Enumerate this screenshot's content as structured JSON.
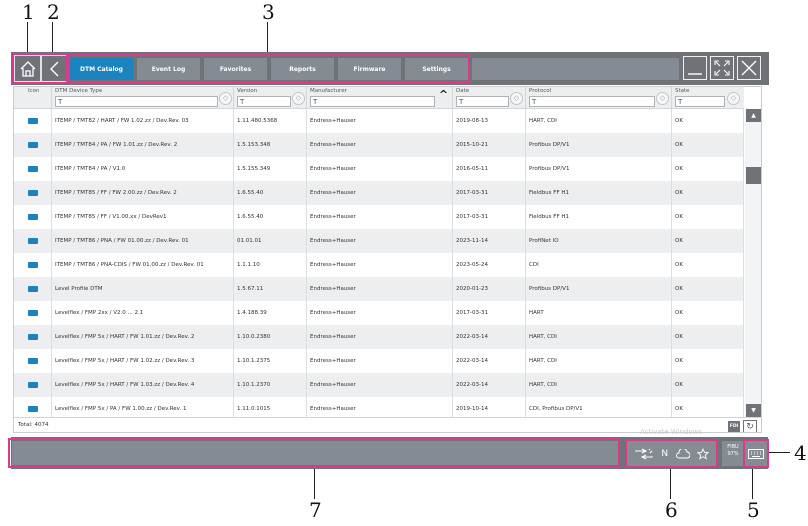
{
  "callouts": {
    "c1": "1",
    "c2": "2",
    "c3": "3",
    "c4": "4",
    "c5": "5",
    "c6": "6",
    "c7": "7"
  },
  "tabs": [
    {
      "label": "DTM Catalog",
      "active": true
    },
    {
      "label": "Event Log"
    },
    {
      "label": "Favorites"
    },
    {
      "label": "Reports"
    },
    {
      "label": "Firmware"
    },
    {
      "label": "Settings"
    }
  ],
  "icons": {
    "home": "home-icon",
    "back": "back-icon",
    "minimize": "minimize-icon",
    "fullscreen": "fullscreen-icon",
    "close": "close-icon",
    "dtm": "dtm-icon",
    "refresh": "refresh-icon",
    "network": "network-icon",
    "nfc": "nfc-icon",
    "cloud": "cloud-icon",
    "star": "star-icon",
    "keyboard": "keyboard-icon",
    "battery": "battery-icon"
  },
  "table": {
    "columns": [
      "Icon",
      "DTM Device Type",
      "Version",
      "Manufacturer",
      "Date",
      "Protocol",
      "State"
    ],
    "filter_glyph": "T",
    "sort_glyph": "◇",
    "sort_active_glyph": "^",
    "rows": [
      [
        "ITEMP / TMT82 / HART / FW 1.02.zz / Dev.Rev. 03",
        "1.11.480.5368",
        "Endress+Hauser",
        "2019-08-13",
        "HART, CDI",
        "OK"
      ],
      [
        "ITEMP / TMT84 / PA / FW 1.01.zz / Dev.Rev. 2",
        "1.5.153.348",
        "Endress+Hauser",
        "2015-10-21",
        "Profibus DP/V1",
        "OK"
      ],
      [
        "ITEMP / TMT84 / PA / V1.0",
        "1.5.155.349",
        "Endress+Hauser",
        "2016-05-11",
        "Profibus DP/V1",
        "OK"
      ],
      [
        "ITEMP / TMT85 / FF / FW 2.00.zz / Dev.Rev. 2",
        "1.6.55.40",
        "Endress+Hauser",
        "2017-03-31",
        "Fieldbus FF H1",
        "OK"
      ],
      [
        "ITEMP / TMT85 / FF / V1.00.xx / DevRev1",
        "1.6.55.40",
        "Endress+Hauser",
        "2017-03-31",
        "Fieldbus FF H1",
        "OK"
      ],
      [
        "ITEMP / TMT86 / PNA / FW 01.00.zz / Dev.Rev. 01",
        "01.01.01",
        "Endress+Hauser",
        "2023-11-14",
        "ProfiNet IO",
        "OK"
      ],
      [
        "ITEMP / TMT86 / PNA-CDIS / FW 01.00.zz / Dev.Rev. 01",
        "1.1.1.10",
        "Endress+Hauser",
        "2023-05-24",
        "CDI",
        "OK"
      ],
      [
        "Level Profile DTM",
        "1.5.67.11",
        "Endress+Hauser",
        "2020-01-23",
        "Profibus DP/V1",
        "OK"
      ],
      [
        "Levelflex / FMP 2xx / V2.0 ... 2.1",
        "1.4.188.39",
        "Endress+Hauser",
        "2017-03-31",
        "HART",
        "OK"
      ],
      [
        "Levelflex / FMP 5x / HART / FW 1.01.zz / Dev.Rev. 2",
        "1.10.0.2380",
        "Endress+Hauser",
        "2022-03-14",
        "HART, CDI",
        "OK"
      ],
      [
        "Levelflex / FMP 5x / HART / FW 1.02.zz / Dev.Rev. 3",
        "1.10.1.2375",
        "Endress+Hauser",
        "2022-03-14",
        "HART, CDI",
        "OK"
      ],
      [
        "Levelflex / FMP 5x / HART / FW 1.03.zz / Dev.Rev. 4",
        "1.10.1.2370",
        "Endress+Hauser",
        "2022-03-14",
        "HART, CDI",
        "OK"
      ],
      [
        "Levelflex / FMP 5x / PA / FW 1.00.zz / Dev.Rev. 1",
        "1.11.0.1015",
        "Endress+Hauser",
        "2019-10-14",
        "CDI, Profibus DP/V1",
        "OK"
      ]
    ],
    "total": "Total: 4074",
    "fdi_label": "FDI",
    "scroll_up": "▲",
    "scroll_down": "▼",
    "refresh_glyph": "↻"
  },
  "watermark": "Activate Windows",
  "statusbar": {
    "nfc_label": "N",
    "battery_label": "FIBU",
    "battery_percent": "97%"
  }
}
